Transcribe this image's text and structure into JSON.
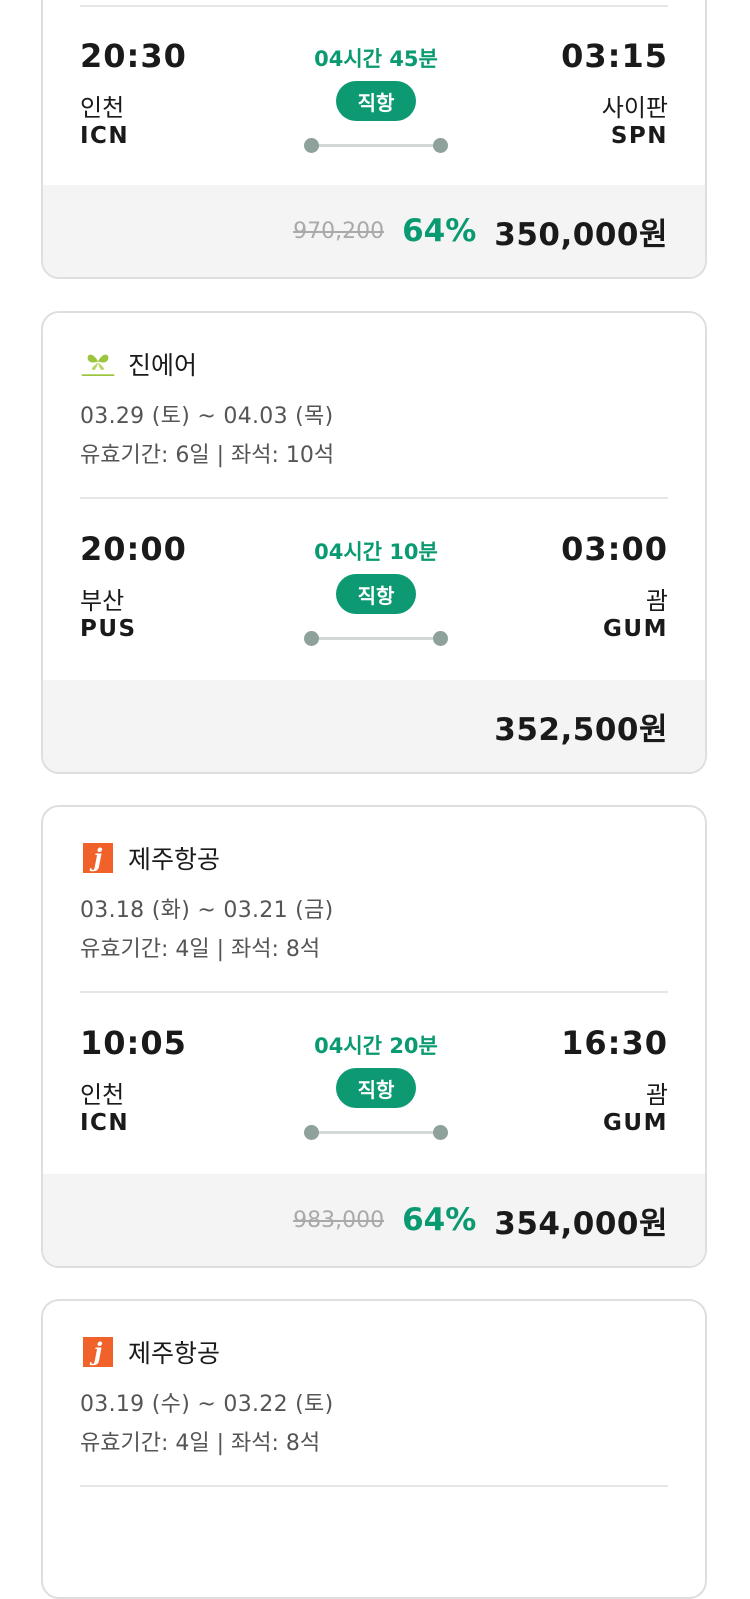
{
  "flights": [
    {
      "airline": "",
      "dates": "",
      "validity": "",
      "dep_time": "20:30",
      "dep_city": "인천",
      "dep_code": "ICN",
      "duration": "04시간 45분",
      "direct": "직항",
      "arr_time": "03:15",
      "arr_city": "사이판",
      "arr_code": "SPN",
      "orig_price": "970,200",
      "discount": "64%",
      "price": "350,000원"
    },
    {
      "airline": "진에어",
      "logo_icon": "jinair-logo-icon",
      "dates": "03.29 (토) ~ 04.03 (목)",
      "validity": "유효기간: 6일 | 좌석: 10석",
      "dep_time": "20:00",
      "dep_city": "부산",
      "dep_code": "PUS",
      "duration": "04시간 10분",
      "direct": "직항",
      "arr_time": "03:00",
      "arr_city": "괌",
      "arr_code": "GUM",
      "orig_price": "",
      "discount": "",
      "price": "352,500원"
    },
    {
      "airline": "제주항공",
      "logo_icon": "jejuair-logo-icon",
      "dates": "03.18 (화) ~ 03.21 (금)",
      "validity": "유효기간: 4일 | 좌석: 8석",
      "dep_time": "10:05",
      "dep_city": "인천",
      "dep_code": "ICN",
      "duration": "04시간 20분",
      "direct": "직항",
      "arr_time": "16:30",
      "arr_city": "괌",
      "arr_code": "GUM",
      "orig_price": "983,000",
      "discount": "64%",
      "price": "354,000원"
    },
    {
      "airline": "제주항공",
      "logo_icon": "jejuair-logo-icon",
      "dates": "03.19 (수) ~ 03.22 (토)",
      "validity": "유효기간: 4일 | 좌석: 8석"
    }
  ],
  "colors": {
    "accent": "#0a9a72",
    "jeju_orange": "#f0622a",
    "jinair_green": "#9bc53d"
  }
}
